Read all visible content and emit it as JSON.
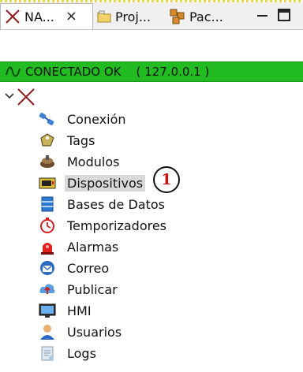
{
  "tabs": [
    {
      "label": "NA...",
      "close": "×",
      "icon": "x-icon",
      "active": true
    },
    {
      "label": "Proj...",
      "icon": "folder-icon",
      "active": false
    },
    {
      "label": "Pac...",
      "icon": "packages-icon",
      "active": false
    }
  ],
  "window_controls": {
    "minimize": "minimize-icon",
    "maximize": "maximize-icon"
  },
  "status": {
    "text": "CONECTADO OK    ( 127.0.0.1 )",
    "icon": "connection-wave-icon",
    "color": "#22bb22"
  },
  "tree": {
    "root_icon": "x-icon",
    "items": [
      {
        "label": "Conexión",
        "icon": "connection-plugs-icon"
      },
      {
        "label": "Tags",
        "icon": "tag-icon"
      },
      {
        "label": "Modulos",
        "icon": "module-icon"
      },
      {
        "label": "Dispositivos",
        "icon": "device-icon",
        "selected": true
      },
      {
        "label": "Bases de Datos",
        "icon": "database-icon"
      },
      {
        "label": "Temporizadores",
        "icon": "timer-icon"
      },
      {
        "label": "Alarmas",
        "icon": "alarm-icon"
      },
      {
        "label": "Correo",
        "icon": "mail-icon"
      },
      {
        "label": "Publicar",
        "icon": "publish-cloud-icon"
      },
      {
        "label": "HMI",
        "icon": "monitor-icon"
      },
      {
        "label": "Usuarios",
        "icon": "user-icon"
      },
      {
        "label": "Logs",
        "icon": "logs-icon"
      }
    ]
  },
  "callout": {
    "number": "1"
  }
}
